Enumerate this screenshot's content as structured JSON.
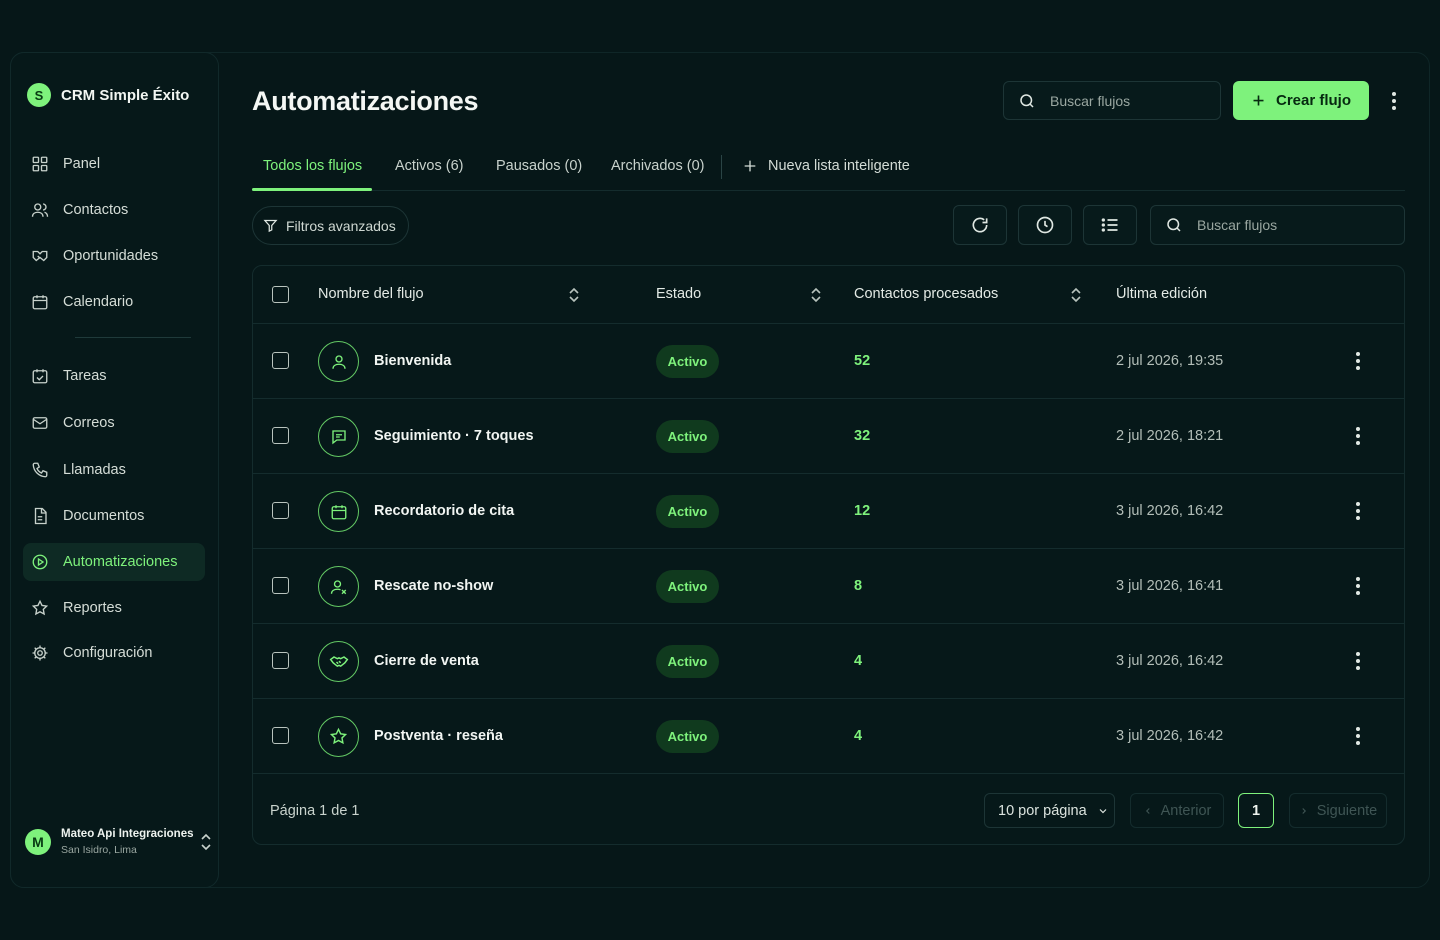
{
  "brand": {
    "logo_letter": "S",
    "name": "CRM Simple Éxito"
  },
  "sidebar": {
    "items": [
      {
        "label": "Panel",
        "icon": "grid-icon"
      },
      {
        "label": "Contactos",
        "icon": "users-icon"
      },
      {
        "label": "Oportunidades",
        "icon": "handshake-icon"
      },
      {
        "label": "Calendario",
        "icon": "calendar-icon"
      },
      {
        "label": "Tareas",
        "icon": "checkbox-icon"
      },
      {
        "label": "Correos",
        "icon": "mail-icon"
      },
      {
        "label": "Llamadas",
        "icon": "phone-icon"
      },
      {
        "label": "Documentos",
        "icon": "document-icon"
      },
      {
        "label": "Automatizaciones",
        "icon": "play-circle-icon",
        "active": true
      },
      {
        "label": "Reportes",
        "icon": "star-icon"
      },
      {
        "label": "Configuración",
        "icon": "gear-icon"
      }
    ]
  },
  "user": {
    "initial": "M",
    "name": "Mateo Api Integraciones",
    "location": "San Isidro, Lima"
  },
  "header": {
    "title": "Automatizaciones",
    "search_placeholder": "Buscar flujos",
    "create_label": "Crear flujo"
  },
  "tabs": [
    {
      "label": "Todos los flujos",
      "active": true
    },
    {
      "label": "Activos (6)"
    },
    {
      "label": "Pausados (0)"
    },
    {
      "label": "Archivados (0)"
    }
  ],
  "new_list_label": "Nueva lista inteligente",
  "toolbar": {
    "filters_label": "Filtros avanzados",
    "search_placeholder": "Buscar flujos"
  },
  "table": {
    "columns": [
      "Nombre del flujo",
      "Estado",
      "Contactos procesados",
      "Última edición"
    ],
    "rows": [
      {
        "name": "Bienvenida",
        "icon": "user-icon",
        "status": "Activo",
        "count": "52",
        "edited": "2 jul 2026, 19:35"
      },
      {
        "name": "Seguimiento · 7 toques",
        "icon": "message-icon",
        "status": "Activo",
        "count": "32",
        "edited": "2 jul 2026, 18:21"
      },
      {
        "name": "Recordatorio de cita",
        "icon": "calendar-icon",
        "status": "Activo",
        "count": "12",
        "edited": "3 jul 2026, 16:42"
      },
      {
        "name": "Rescate no-show",
        "icon": "user-x-icon",
        "status": "Activo",
        "count": "8",
        "edited": "3 jul 2026, 16:41"
      },
      {
        "name": "Cierre de venta",
        "icon": "handshake-icon",
        "status": "Activo",
        "count": "4",
        "edited": "3 jul 2026, 16:42"
      },
      {
        "name": "Postventa · reseña",
        "icon": "star-icon",
        "status": "Activo",
        "count": "4",
        "edited": "3 jul 2026, 16:42"
      }
    ]
  },
  "pagination": {
    "info": "Página 1 de 1",
    "per_page": "10 por página",
    "prev": "Anterior",
    "current": "1",
    "next": "Siguiente"
  },
  "colors": {
    "accent": "#7ef27c",
    "background": "#061718",
    "badge_bg": "#103a1e"
  }
}
